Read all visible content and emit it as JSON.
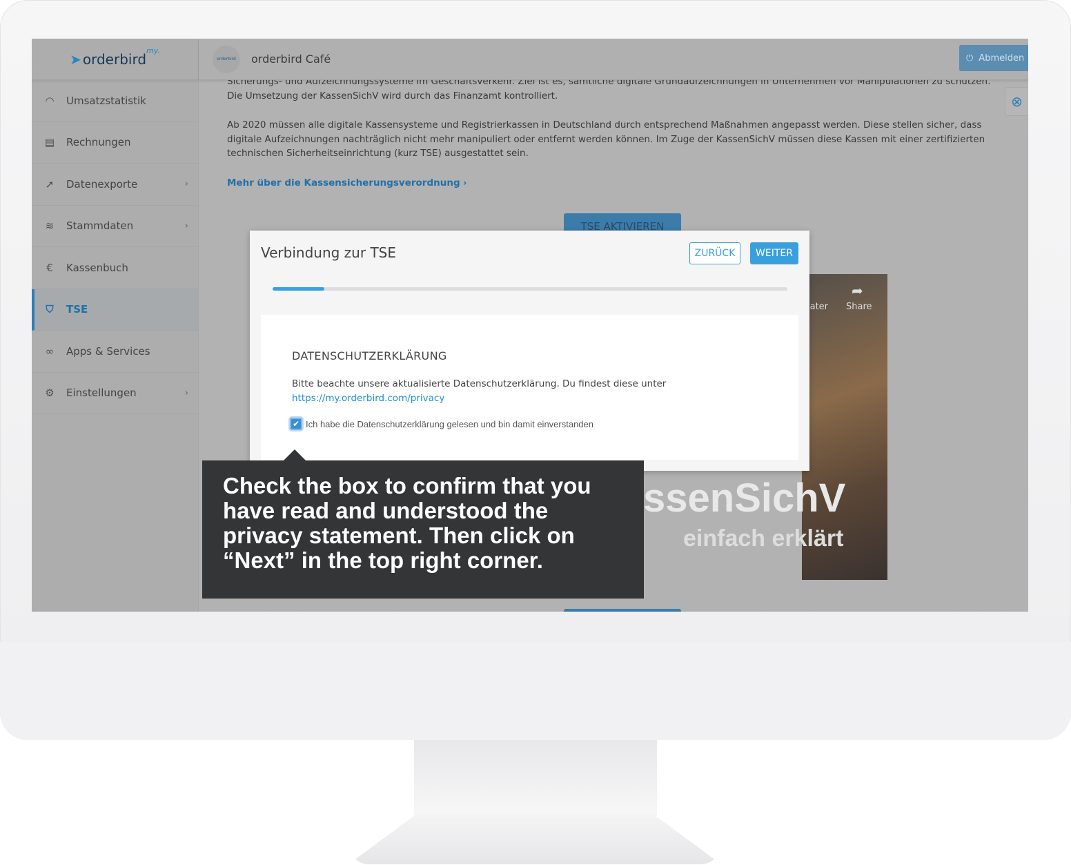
{
  "app": {
    "logo_text": "orderbird",
    "logo_prefix": "my.",
    "cafe_name": "orderbird Café",
    "avatar_text": "orderbird",
    "logout_label": "Abmelden"
  },
  "sidebar": {
    "items": [
      {
        "label": "Umsatzstatistik",
        "icon": "gauge-icon",
        "chevron": false
      },
      {
        "label": "Rechnungen",
        "icon": "receipt-icon",
        "chevron": false
      },
      {
        "label": "Datenexporte",
        "icon": "export-arrow-icon",
        "chevron": true
      },
      {
        "label": "Stammdaten",
        "icon": "layers-icon",
        "chevron": true
      },
      {
        "label": "Kassenbuch",
        "icon": "cashbook-icon",
        "chevron": false
      },
      {
        "label": "TSE",
        "icon": "shield-lock-icon",
        "chevron": false,
        "active": true
      },
      {
        "label": "Apps & Services",
        "icon": "rings-icon",
        "chevron": false
      },
      {
        "label": "Einstellungen",
        "icon": "gear-icon",
        "chevron": true
      }
    ]
  },
  "content": {
    "para1": "Sicherungs- und Aufzeichnungssysteme im Geschäftsverkehr. Ziel ist es, sämtliche digitale Grundaufzeichnungen in Unternehmen vor Manipulationen zu schützen. Die Umsetzung der KassenSichV wird durch das Finanzamt kontrolliert.",
    "para2": "Ab 2020 müssen alle digitale Kassensysteme und Registrierkassen in Deutschland durch entsprechend Maßnahmen angepasst werden. Diese stellen sicher, dass digitale Aufzeichnungen nachträglich nicht mehr manipuliert oder entfernt werden können. Im Zuge der KassenSichV müssen diese Kassen mit einer zertifizierten technischen Sicherheitseinrichtung (kurz TSE) ausgestattet sein.",
    "more_link": "Mehr über die Kassensicherungsverordnung",
    "activate_button": "TSE AKTIVIEREN",
    "video": {
      "later": "later",
      "share": "Share",
      "title_big": "ssenSichV",
      "subtitle": "einfach erklärt"
    }
  },
  "modal": {
    "title": "Verbindung zur TSE",
    "back_label": "ZURÜCK",
    "next_label": "WEITER",
    "progress_percent": 10,
    "heading": "DATENSCHUTZERKLÄRUNG",
    "text": "Bitte beachte unsere aktualisierte Datenschutzerklärung. Du findest diese unter",
    "link": "https://my.orderbird.com/privacy",
    "checkbox_label": "Ich habe die Datenschutzerklärung gelesen und bin damit einverstanden",
    "checkbox_checked": true
  },
  "tooltip": {
    "text": "Check the box to confirm that you have read and understood the privacy statement. Then click on “Next” in the top right corner."
  },
  "colors": {
    "accent": "#3aa0dd",
    "tooltip_bg": "#343536"
  }
}
